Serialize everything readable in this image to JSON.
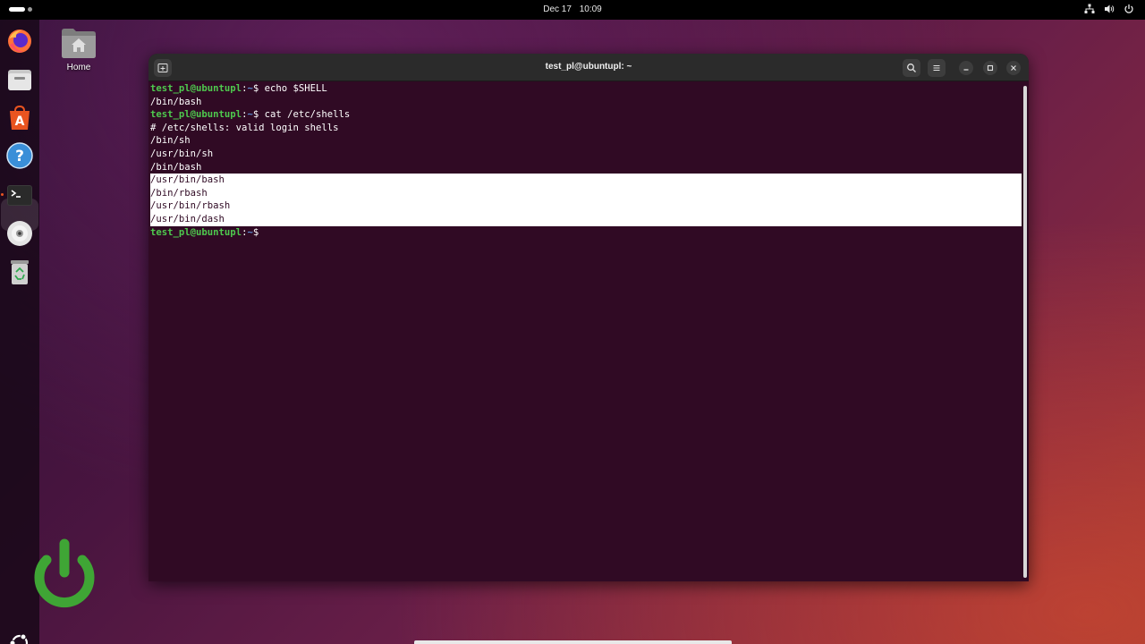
{
  "topbar": {
    "date": "Dec 17",
    "time": "10:09",
    "tray_icons": [
      "network-icon",
      "volume-icon",
      "power-icon"
    ]
  },
  "dock": {
    "items": [
      {
        "name": "firefox",
        "icon": "firefox-icon"
      },
      {
        "name": "files",
        "icon": "files-icon"
      },
      {
        "name": "app-center",
        "icon": "app-center-icon"
      },
      {
        "name": "help",
        "icon": "help-icon"
      },
      {
        "name": "terminal",
        "icon": "terminal-icon",
        "active": true
      },
      {
        "name": "disc",
        "icon": "disc-icon"
      },
      {
        "name": "trash",
        "icon": "trash-icon"
      }
    ],
    "show_apps_icon": "ubuntu-logo-icon"
  },
  "desktop": {
    "home_label": "Home"
  },
  "window": {
    "title": "test_pl@ubuntupl: ~",
    "buttons": [
      "new-tab",
      "search",
      "menu",
      "minimize",
      "maximize",
      "close"
    ]
  },
  "terminal": {
    "prompt_user": "test_pl@ubuntupl",
    "prompt_sep": ":",
    "prompt_path": "~",
    "prompt_dollar": "$",
    "cmd1": " echo $SHELL",
    "out1": "/bin/bash",
    "cmd2": " cat /etc/shells",
    "shells_lines": [
      "# /etc/shells: valid login shells",
      "/bin/sh",
      "/usr/bin/sh",
      "/bin/bash",
      "/usr/bin/bash",
      "/bin/rbash",
      "/usr/bin/rbash",
      "/usr/bin/dash"
    ],
    "selected_lines": [
      4,
      5,
      6,
      7
    ]
  },
  "colors": {
    "terminal_bg": "#300a24",
    "prompt_user": "#4ec94e",
    "prompt_path": "#5d8fd6",
    "accent": "#e95420",
    "power_logo": "#3fa535"
  }
}
